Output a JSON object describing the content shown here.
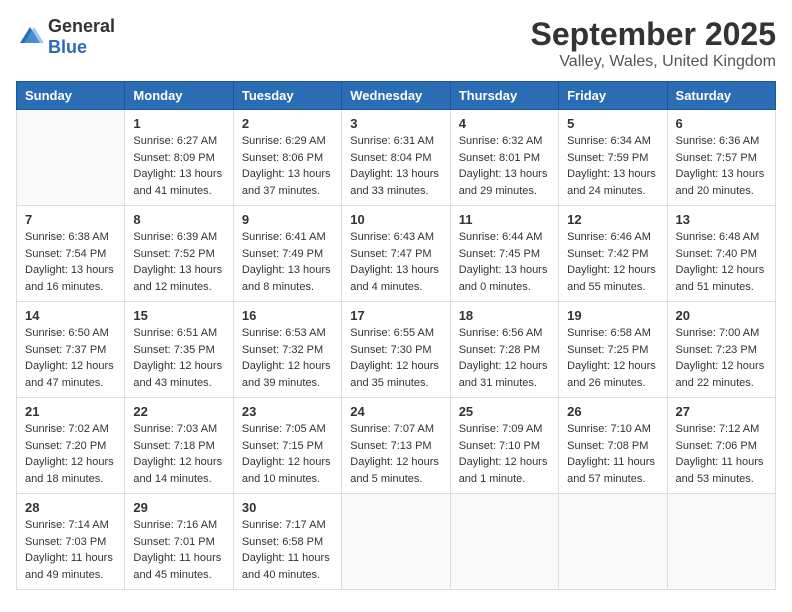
{
  "logo": {
    "general": "General",
    "blue": "Blue"
  },
  "title": "September 2025",
  "location": "Valley, Wales, United Kingdom",
  "days_of_week": [
    "Sunday",
    "Monday",
    "Tuesday",
    "Wednesday",
    "Thursday",
    "Friday",
    "Saturday"
  ],
  "weeks": [
    [
      {
        "day": "",
        "info": ""
      },
      {
        "day": "1",
        "info": "Sunrise: 6:27 AM\nSunset: 8:09 PM\nDaylight: 13 hours\nand 41 minutes."
      },
      {
        "day": "2",
        "info": "Sunrise: 6:29 AM\nSunset: 8:06 PM\nDaylight: 13 hours\nand 37 minutes."
      },
      {
        "day": "3",
        "info": "Sunrise: 6:31 AM\nSunset: 8:04 PM\nDaylight: 13 hours\nand 33 minutes."
      },
      {
        "day": "4",
        "info": "Sunrise: 6:32 AM\nSunset: 8:01 PM\nDaylight: 13 hours\nand 29 minutes."
      },
      {
        "day": "5",
        "info": "Sunrise: 6:34 AM\nSunset: 7:59 PM\nDaylight: 13 hours\nand 24 minutes."
      },
      {
        "day": "6",
        "info": "Sunrise: 6:36 AM\nSunset: 7:57 PM\nDaylight: 13 hours\nand 20 minutes."
      }
    ],
    [
      {
        "day": "7",
        "info": "Sunrise: 6:38 AM\nSunset: 7:54 PM\nDaylight: 13 hours\nand 16 minutes."
      },
      {
        "day": "8",
        "info": "Sunrise: 6:39 AM\nSunset: 7:52 PM\nDaylight: 13 hours\nand 12 minutes."
      },
      {
        "day": "9",
        "info": "Sunrise: 6:41 AM\nSunset: 7:49 PM\nDaylight: 13 hours\nand 8 minutes."
      },
      {
        "day": "10",
        "info": "Sunrise: 6:43 AM\nSunset: 7:47 PM\nDaylight: 13 hours\nand 4 minutes."
      },
      {
        "day": "11",
        "info": "Sunrise: 6:44 AM\nSunset: 7:45 PM\nDaylight: 13 hours\nand 0 minutes."
      },
      {
        "day": "12",
        "info": "Sunrise: 6:46 AM\nSunset: 7:42 PM\nDaylight: 12 hours\nand 55 minutes."
      },
      {
        "day": "13",
        "info": "Sunrise: 6:48 AM\nSunset: 7:40 PM\nDaylight: 12 hours\nand 51 minutes."
      }
    ],
    [
      {
        "day": "14",
        "info": "Sunrise: 6:50 AM\nSunset: 7:37 PM\nDaylight: 12 hours\nand 47 minutes."
      },
      {
        "day": "15",
        "info": "Sunrise: 6:51 AM\nSunset: 7:35 PM\nDaylight: 12 hours\nand 43 minutes."
      },
      {
        "day": "16",
        "info": "Sunrise: 6:53 AM\nSunset: 7:32 PM\nDaylight: 12 hours\nand 39 minutes."
      },
      {
        "day": "17",
        "info": "Sunrise: 6:55 AM\nSunset: 7:30 PM\nDaylight: 12 hours\nand 35 minutes."
      },
      {
        "day": "18",
        "info": "Sunrise: 6:56 AM\nSunset: 7:28 PM\nDaylight: 12 hours\nand 31 minutes."
      },
      {
        "day": "19",
        "info": "Sunrise: 6:58 AM\nSunset: 7:25 PM\nDaylight: 12 hours\nand 26 minutes."
      },
      {
        "day": "20",
        "info": "Sunrise: 7:00 AM\nSunset: 7:23 PM\nDaylight: 12 hours\nand 22 minutes."
      }
    ],
    [
      {
        "day": "21",
        "info": "Sunrise: 7:02 AM\nSunset: 7:20 PM\nDaylight: 12 hours\nand 18 minutes."
      },
      {
        "day": "22",
        "info": "Sunrise: 7:03 AM\nSunset: 7:18 PM\nDaylight: 12 hours\nand 14 minutes."
      },
      {
        "day": "23",
        "info": "Sunrise: 7:05 AM\nSunset: 7:15 PM\nDaylight: 12 hours\nand 10 minutes."
      },
      {
        "day": "24",
        "info": "Sunrise: 7:07 AM\nSunset: 7:13 PM\nDaylight: 12 hours\nand 5 minutes."
      },
      {
        "day": "25",
        "info": "Sunrise: 7:09 AM\nSunset: 7:10 PM\nDaylight: 12 hours\nand 1 minute."
      },
      {
        "day": "26",
        "info": "Sunrise: 7:10 AM\nSunset: 7:08 PM\nDaylight: 11 hours\nand 57 minutes."
      },
      {
        "day": "27",
        "info": "Sunrise: 7:12 AM\nSunset: 7:06 PM\nDaylight: 11 hours\nand 53 minutes."
      }
    ],
    [
      {
        "day": "28",
        "info": "Sunrise: 7:14 AM\nSunset: 7:03 PM\nDaylight: 11 hours\nand 49 minutes."
      },
      {
        "day": "29",
        "info": "Sunrise: 7:16 AM\nSunset: 7:01 PM\nDaylight: 11 hours\nand 45 minutes."
      },
      {
        "day": "30",
        "info": "Sunrise: 7:17 AM\nSunset: 6:58 PM\nDaylight: 11 hours\nand 40 minutes."
      },
      {
        "day": "",
        "info": ""
      },
      {
        "day": "",
        "info": ""
      },
      {
        "day": "",
        "info": ""
      },
      {
        "day": "",
        "info": ""
      }
    ]
  ]
}
